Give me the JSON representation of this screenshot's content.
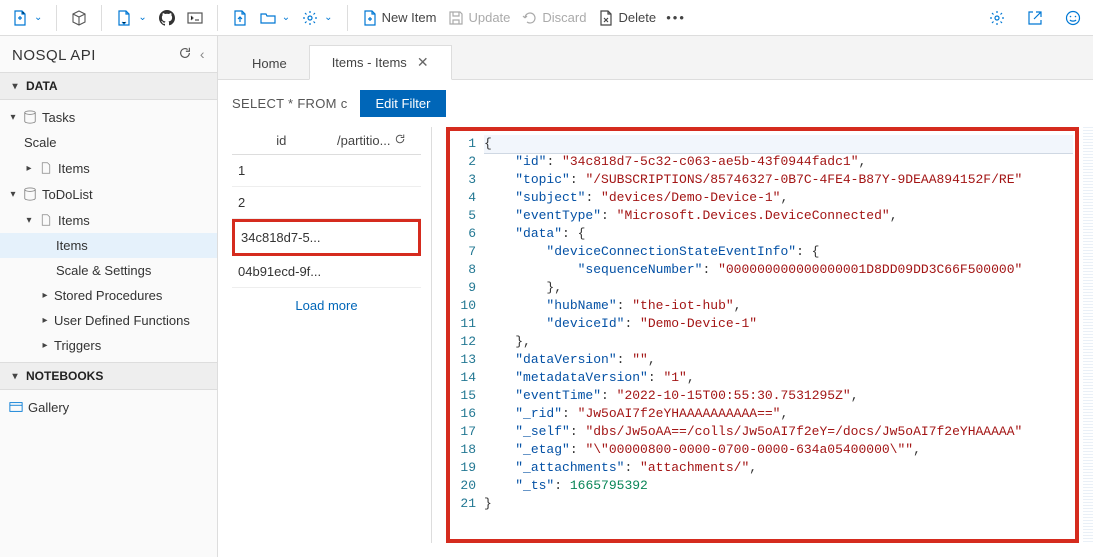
{
  "toolbar": {
    "new_item": "New Item",
    "update": "Update",
    "discard": "Discard",
    "delete": "Delete"
  },
  "sidebar": {
    "title": "NOSQL API",
    "section_data": "DATA",
    "section_notebooks": "NOTEBOOKS",
    "tasks": "Tasks",
    "tasks_scale": "Scale",
    "tasks_items": "Items",
    "todolist": "ToDoList",
    "tdl_items": "Items",
    "tdl_items_items": "Items",
    "tdl_scale_settings": "Scale & Settings",
    "tdl_stored": "Stored Procedures",
    "tdl_udf": "User Defined Functions",
    "tdl_triggers": "Triggers",
    "gallery": "Gallery"
  },
  "tabs": {
    "home": "Home",
    "items": "Items - Items"
  },
  "filter": {
    "query": "SELECT * FROM c",
    "edit": "Edit Filter"
  },
  "itemlist": {
    "col_id": "id",
    "col_pk": "/partitio...",
    "rows": [
      {
        "label": "1"
      },
      {
        "label": "2"
      },
      {
        "label": "34c818d7-5...",
        "selected": true
      },
      {
        "label": "04b91ecd-9f..."
      }
    ],
    "load_more": "Load more"
  },
  "json_doc": {
    "id": "34c818d7-5c32-c063-ae5b-43f0944fadc1",
    "topic": "/SUBSCRIPTIONS/85746327-0B7C-4FE4-B87Y-9DEAA894152F/RE",
    "subject": "devices/Demo-Device-1",
    "eventType": "Microsoft.Devices.DeviceConnected",
    "sequenceNumber": "000000000000000001D8DD09DD3C66F500000",
    "hubName": "the-iot-hub",
    "deviceId": "Demo-Device-1",
    "dataVersion": "",
    "metadataVersion": "1",
    "eventTime": "2022-10-15T00:55:30.7531295Z",
    "_rid": "Jw5oAI7f2eYHAAAAAAAAAA==",
    "_self": "dbs/Jw5oAA==/colls/Jw5oAI7f2eY=/docs/Jw5oAI7f2eYHAAAAA",
    "_etag": "\\\"00000800-0000-0700-0000-634a05400000\\\"",
    "_attachments": "attachments/",
    "_ts": "1665795392"
  }
}
